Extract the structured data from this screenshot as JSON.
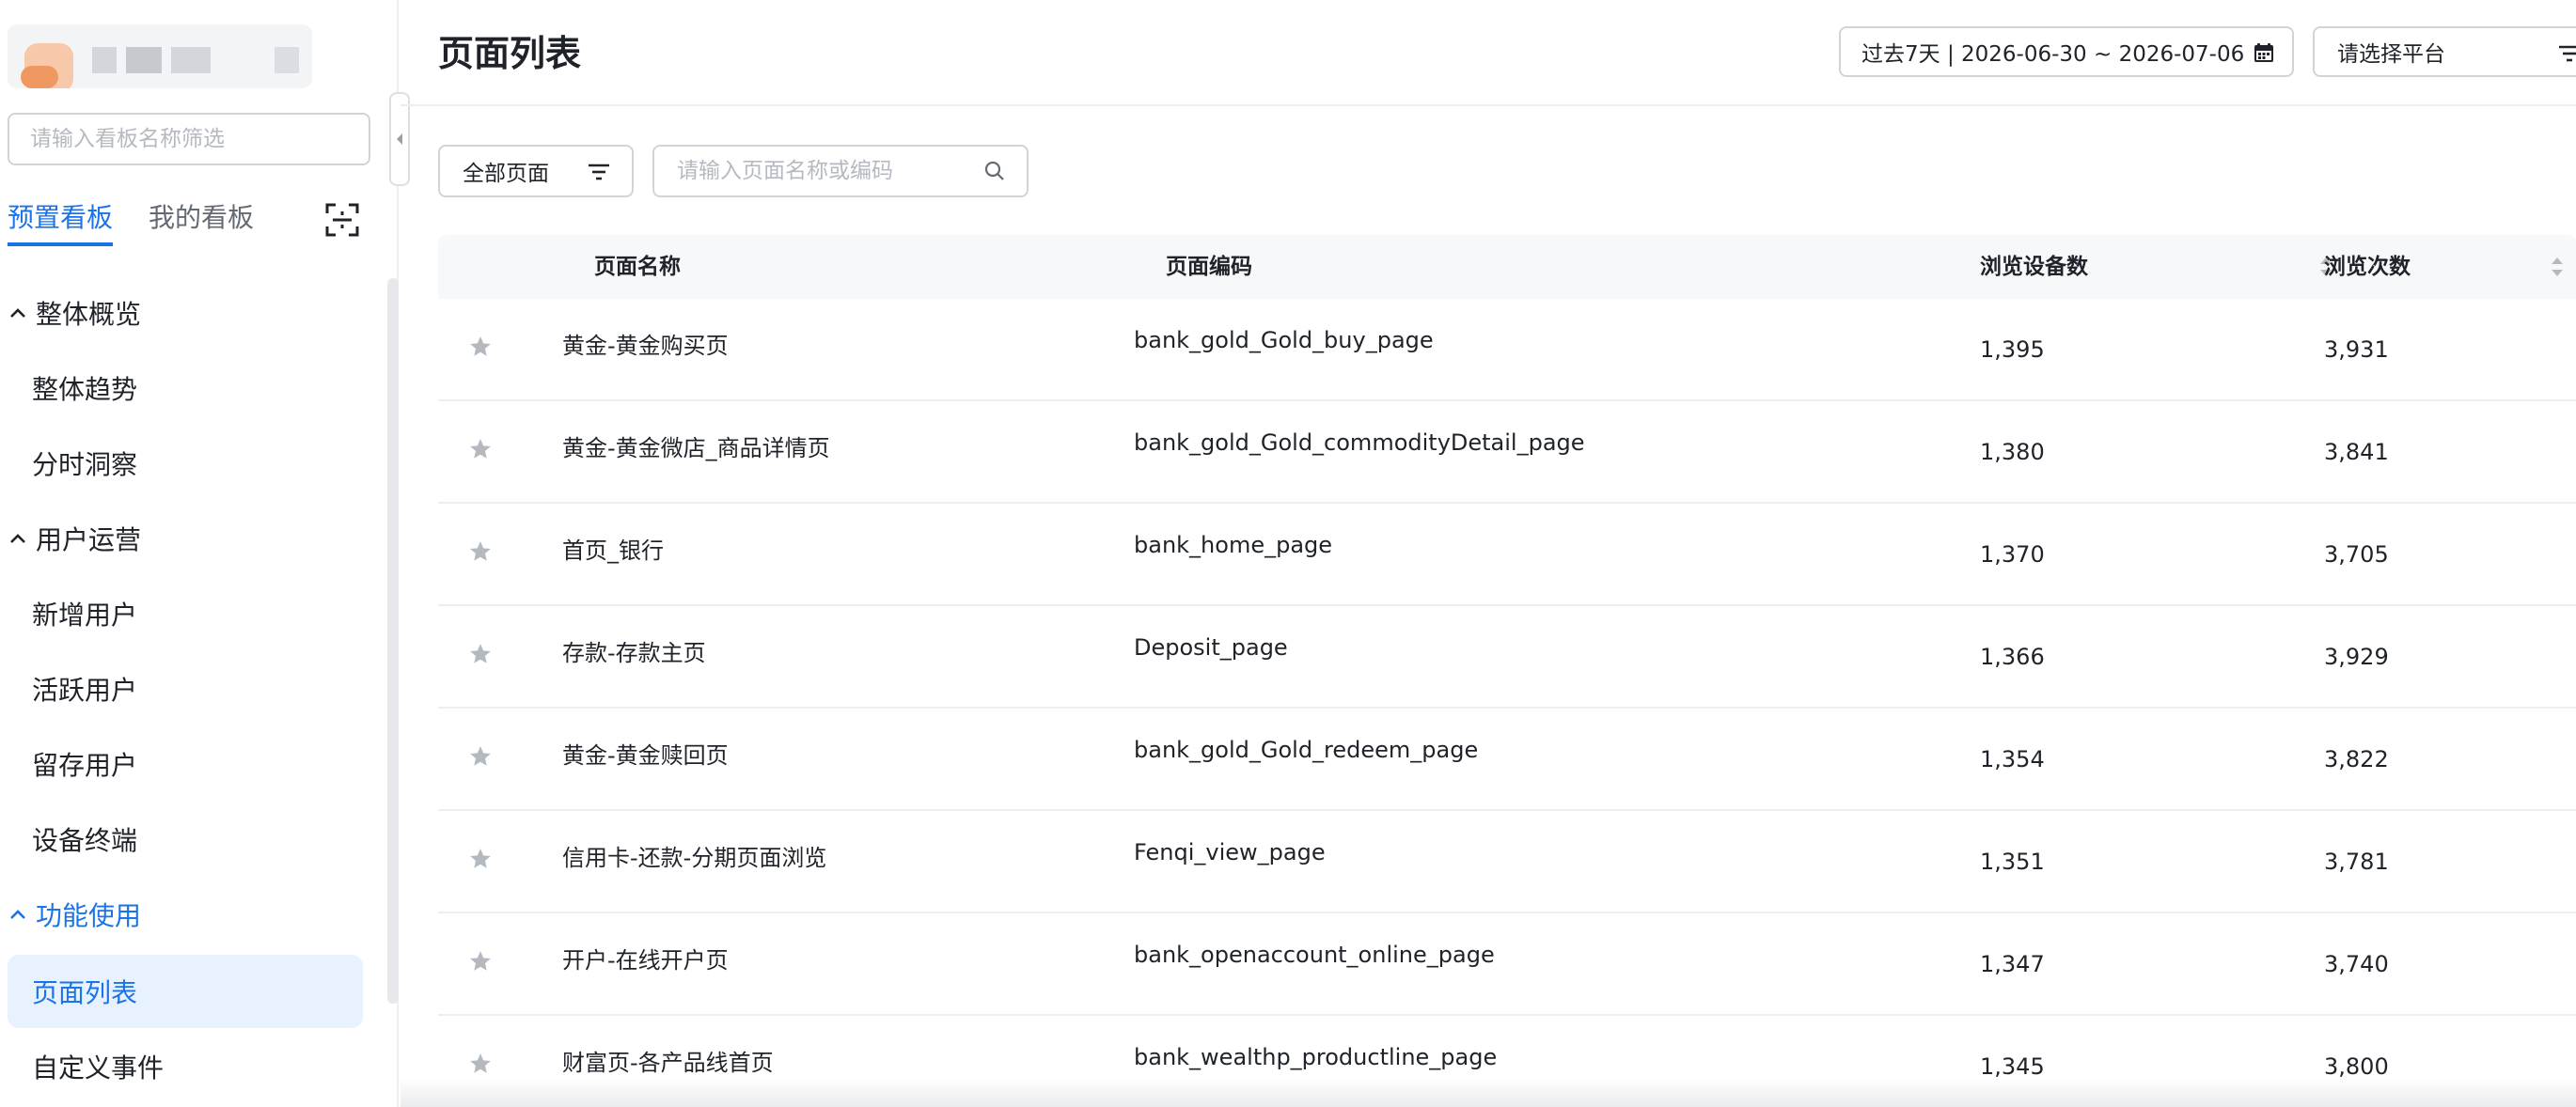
{
  "sidebar": {
    "search_placeholder": "请输入看板名称筛选",
    "tabs": [
      {
        "label": "预置看板",
        "active": true
      },
      {
        "label": "我的看板",
        "active": false
      }
    ],
    "groups": [
      {
        "label": "整体概览",
        "items": [
          "整体趋势",
          "分时洞察"
        ]
      },
      {
        "label": "用户运营",
        "items": [
          "新增用户",
          "活跃用户",
          "留存用户",
          "设备终端"
        ]
      },
      {
        "label": "功能使用",
        "items": [
          "页面列表",
          "自定义事件"
        ]
      }
    ],
    "active_group": "功能使用",
    "active_item": "页面列表"
  },
  "header": {
    "title": "页面列表",
    "date_range": "过去7天 | 2026-06-30 ~ 2026-07-06",
    "platform_placeholder": "请选择平台"
  },
  "filters": {
    "page_type": "全部页面",
    "search_placeholder": "请输入页面名称或编码"
  },
  "table": {
    "columns": {
      "name": "页面名称",
      "code": "页面编码",
      "devices": "浏览设备数",
      "views": "浏览次数"
    },
    "rows": [
      {
        "name": "黄金-黄金购买页",
        "code": "bank_gold_Gold_buy_page",
        "devices": "1,395",
        "views": "3,931"
      },
      {
        "name": "黄金-黄金微店_商品详情页",
        "code": "bank_gold_Gold_commodityDetail_page",
        "devices": "1,380",
        "views": "3,841"
      },
      {
        "name": "首页_银行",
        "code": "bank_home_page",
        "devices": "1,370",
        "views": "3,705"
      },
      {
        "name": "存款-存款主页",
        "code": "Deposit_page",
        "devices": "1,366",
        "views": "3,929"
      },
      {
        "name": "黄金-黄金赎回页",
        "code": "bank_gold_Gold_redeem_page",
        "devices": "1,354",
        "views": "3,822"
      },
      {
        "name": "信用卡-还款-分期页面浏览",
        "code": "Fenqi_view_page",
        "devices": "1,351",
        "views": "3,781"
      },
      {
        "name": "开户-在线开户页",
        "code": "bank_openaccount_online_page",
        "devices": "1,347",
        "views": "3,740"
      },
      {
        "name": "财富页-各产品线首页",
        "code": "bank_wealthp_productline_page",
        "devices": "1,345",
        "views": "3,800"
      }
    ]
  },
  "colors": {
    "accent": "#1a73e8",
    "active_bg": "#e8f2ff",
    "header_bg": "#f7f8fa",
    "star": "#b4b8bf"
  }
}
